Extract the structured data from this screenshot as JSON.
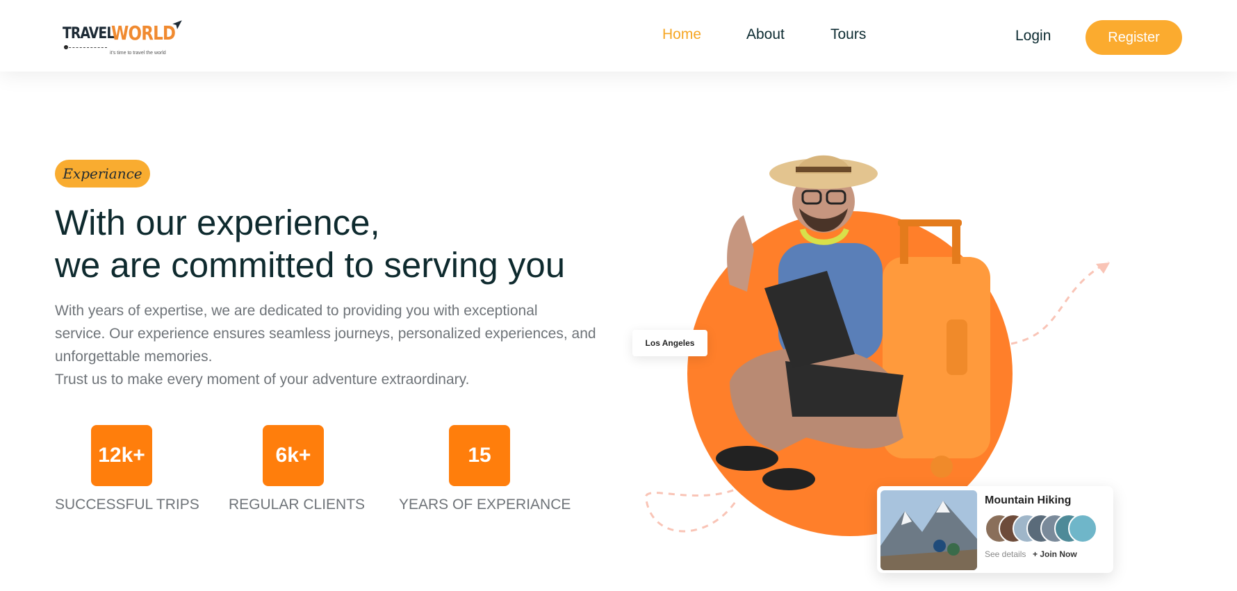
{
  "brand": {
    "name_part1": "TRAVEL",
    "name_part2": "WORLD",
    "tagline": "it's time to travel the world"
  },
  "nav": {
    "items": [
      {
        "label": "Home",
        "active": true
      },
      {
        "label": "About",
        "active": false
      },
      {
        "label": "Tours",
        "active": false
      }
    ],
    "login_label": "Login",
    "register_label": "Register"
  },
  "hero": {
    "subtitle": "Experiance",
    "title_lines": [
      "With our experience,",
      "we are committed to serving you"
    ],
    "description_lines": [
      "With years of expertise, we are dedicated to providing you with exceptional",
      "service. Our experience ensures seamless journeys, personalized experiences, and",
      "unforgettable memories.",
      "Trust us to make every moment of your adventure extraordinary."
    ],
    "stats": [
      {
        "value": "12k+",
        "label": "SUCCESSFUL TRIPS"
      },
      {
        "value": "6k+",
        "label": "REGULAR CLIENTS"
      },
      {
        "value": "15",
        "label": "YEARS OF EXPERIANCE"
      }
    ]
  },
  "visual": {
    "location_label": "Los Angeles",
    "tour_card": {
      "title": "Mountain Hiking",
      "see_details": "See details",
      "join_now": "+ Join Now"
    }
  },
  "colors": {
    "accent": "#fbab2f",
    "stat_box": "#ff7e0c",
    "circle": "#ff7f2a",
    "heading": "#0e2a2e",
    "body_text": "#6e7378"
  }
}
